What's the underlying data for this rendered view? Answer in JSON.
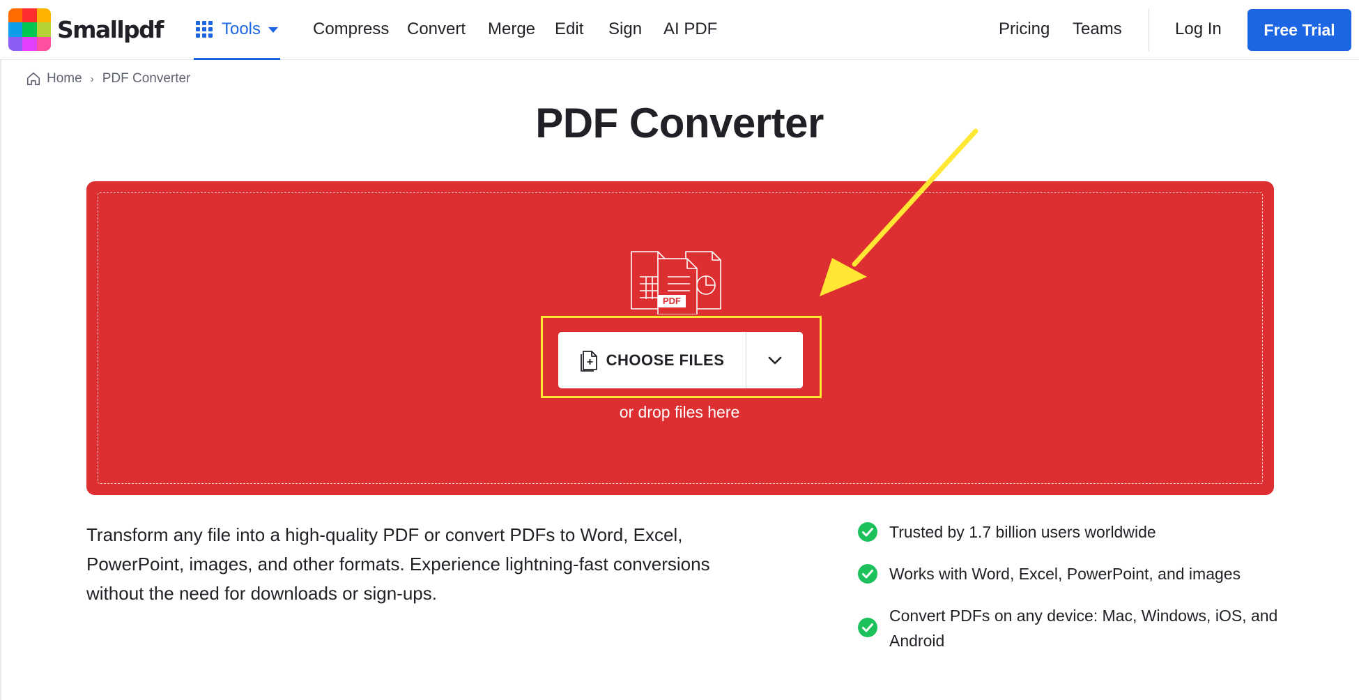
{
  "brand": {
    "name": "Smallpdf",
    "logo_colors": [
      "#ff6b00",
      "#ff2d2d",
      "#ffb300",
      "#0e9de8",
      "#00c853",
      "#b4d335",
      "#8b5cf6",
      "#e040fb",
      "#ff4fa0"
    ]
  },
  "header": {
    "tools_label": "Tools",
    "nav": [
      "Compress",
      "Convert",
      "Merge",
      "Edit",
      "Sign",
      "AI PDF"
    ],
    "pricing": "Pricing",
    "teams": "Teams",
    "login": "Log In",
    "free_trial": "Free Trial"
  },
  "breadcrumb": {
    "home": "Home",
    "separator": "›",
    "current": "PDF Converter"
  },
  "page_title": "PDF Converter",
  "dropzone": {
    "illustration_badge": "PDF",
    "choose_label": "CHOOSE FILES",
    "drop_hint": "or drop files here"
  },
  "description": "Transform any file into a high-quality PDF or convert PDFs to Word, Excel, PowerPoint, images, and other formats. Experience lightning-fast conversions without the need for downloads or sign-ups.",
  "features": [
    "Trusted by 1.7 billion users worldwide",
    "Works with Word, Excel, PowerPoint, and images",
    "Convert PDFs on any device: Mac, Windows, iOS, and Android"
  ],
  "colors": {
    "primary": "#1c65e3",
    "dropzone": "#dd2e31",
    "highlight": "#ffe733",
    "check": "#1dc15b"
  },
  "icons": {
    "tools": "grid-icon",
    "tools_caret": "caret-down-icon",
    "breadcrumb": "home-icon",
    "choose": "file-plus-icon",
    "more": "chevron-down-icon",
    "feature": "check-circle-icon",
    "annotation": "arrow-annotation"
  }
}
